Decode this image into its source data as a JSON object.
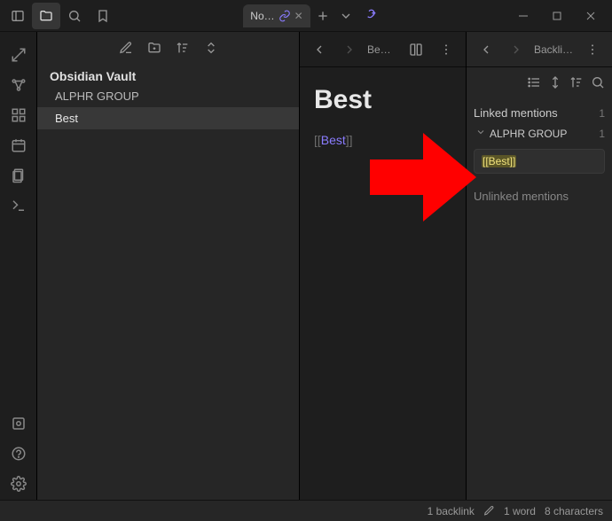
{
  "titlebar": {
    "tab_label": "No…",
    "new_tab_plus": "+"
  },
  "explorer": {
    "vault_title": "Obsidian Vault",
    "files": [
      "ALPHR GROUP",
      "Best"
    ]
  },
  "editor": {
    "header_title": "Be…",
    "note_title": "Best",
    "link_text": "Best"
  },
  "backlinks": {
    "header_title": "Backlin…",
    "linked_label": "Linked mentions",
    "linked_count": "1",
    "group_name": "ALPHR GROUP",
    "group_count": "1",
    "hit_text": "[[Best]]",
    "unlinked_label": "Unlinked mentions"
  },
  "statusbar": {
    "backlinks": "1 backlink",
    "words": "1 word",
    "chars": "8 characters"
  }
}
